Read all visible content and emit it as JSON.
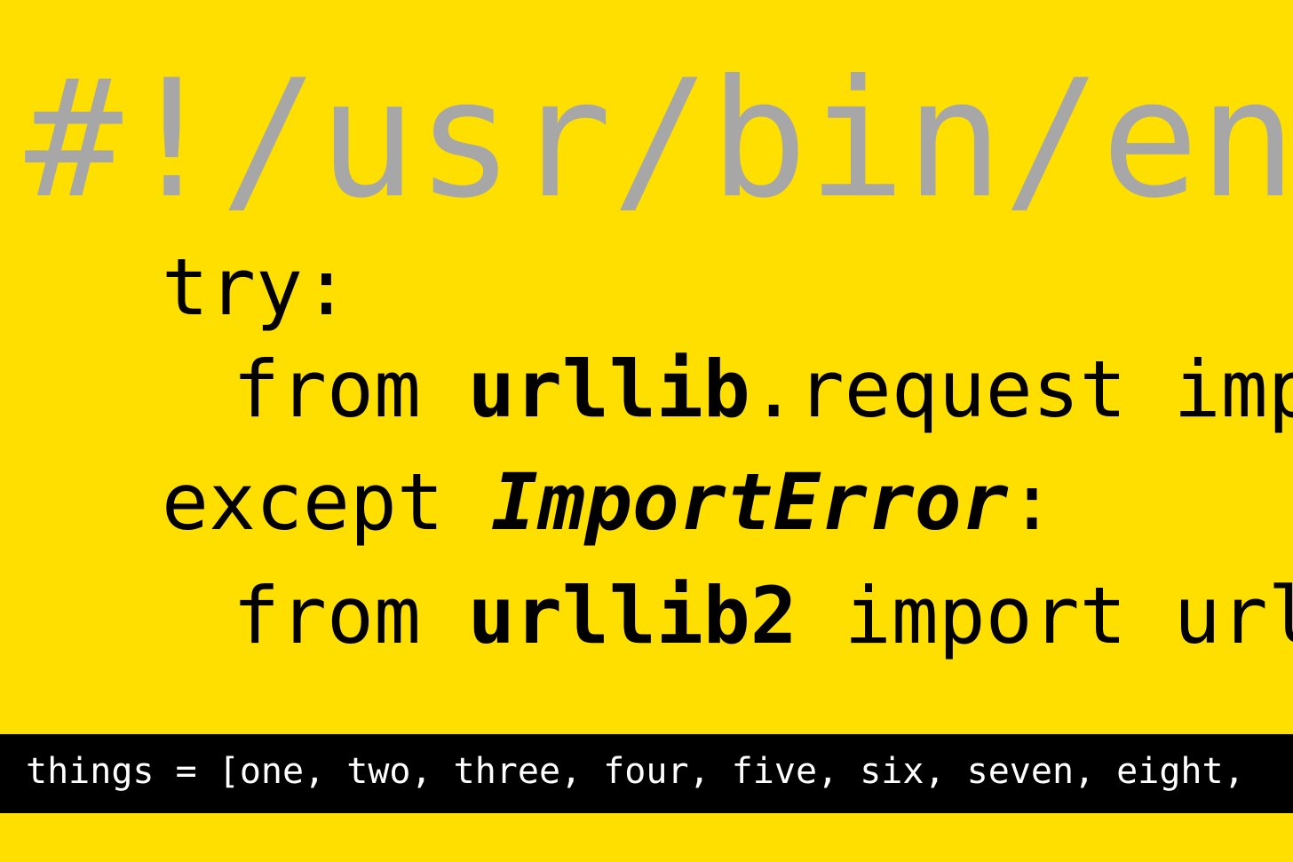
{
  "colors": {
    "background": "#FFDF00",
    "shebang": "#A7A7A7",
    "code": "#000000",
    "bar_background": "#000000",
    "bar_text": "#FFFFFF"
  },
  "shebang": "#!/usr/bin/env",
  "code": {
    "line1": {
      "keyword": "try:"
    },
    "line2": {
      "kw_from": "from ",
      "module": "urllib",
      "rest": ".request impo"
    },
    "line3": {
      "kw_except": "except ",
      "exception": "ImportError",
      "colon": ":"
    },
    "line4": {
      "kw_from": "from ",
      "module": "urllib2",
      "rest": " import urlo"
    }
  },
  "bottom_bar": {
    "text": "things = [one, two, three, four, five, six, seven, eight,"
  }
}
